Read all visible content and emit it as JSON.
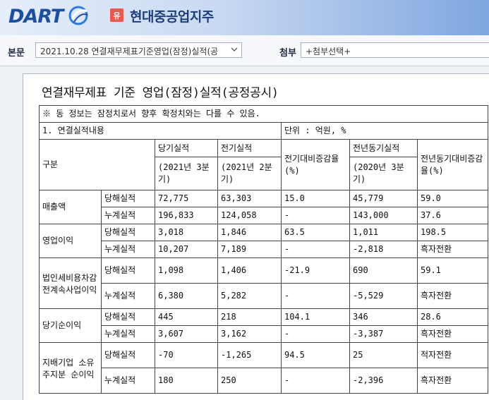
{
  "header": {
    "logo_text": "DART",
    "company_badge": "유",
    "company_name": "현대중공업지주"
  },
  "toolbar": {
    "doc_label": "본문",
    "doc_value": "2021.10.28  연결재무제표기준영업(잠정)실적(공",
    "attach_label": "첨부",
    "attach_value": "+첨부선택+"
  },
  "document": {
    "title": "연결재무제표 기준 영업(잠정)실적(공정공시)",
    "note": "※ 동 정보는 잠정치로서 향후 확정치와는 다를 수 있음.",
    "section": "1. 연결실적내용",
    "unit": "단위 : 억원, %",
    "headers": {
      "category": "구분",
      "current": "당기실적",
      "current_period": "(2021년 3분기)",
      "previous": "전기실적",
      "previous_period": "(2021년 2분기)",
      "qoq": "전기대비증감율(%)",
      "yoy_prev": "전년동기실적",
      "yoy_prev_period": "(2020년 3분기)",
      "yoy": "전년동기대비증감율(%)"
    },
    "rows": [
      {
        "name": "매출액",
        "sub": [
          {
            "type": "당해실적",
            "cur": "72,775",
            "prev": "63,303",
            "qoq": "15.0",
            "yoyp": "45,779",
            "yoy": "59.0"
          },
          {
            "type": "누계실적",
            "cur": "196,833",
            "prev": "124,058",
            "qoq": "-",
            "yoyp": "143,000",
            "yoy": "37.6"
          }
        ]
      },
      {
        "name": "영업이익",
        "sub": [
          {
            "type": "당해실적",
            "cur": "3,018",
            "prev": "1,846",
            "qoq": "63.5",
            "yoyp": "1,011",
            "yoy": "198.5"
          },
          {
            "type": "누계실적",
            "cur": "10,207",
            "prev": "7,189",
            "qoq": "-",
            "yoyp": "-2,818",
            "yoy": "흑자전환"
          }
        ]
      },
      {
        "name": "법인세비용차감전계속사업이익",
        "sub": [
          {
            "type": "당해실적",
            "cur": "1,098",
            "prev": "1,406",
            "qoq": "-21.9",
            "yoyp": "690",
            "yoy": "59.1"
          },
          {
            "type": "누계실적",
            "cur": "6,380",
            "prev": "5,282",
            "qoq": "-",
            "yoyp": "-5,529",
            "yoy": "흑자전환"
          }
        ]
      },
      {
        "name": "당기순이익",
        "sub": [
          {
            "type": "당해실적",
            "cur": "445",
            "prev": "218",
            "qoq": "104.1",
            "yoyp": "346",
            "yoy": "28.6"
          },
          {
            "type": "누계실적",
            "cur": "3,607",
            "prev": "3,162",
            "qoq": "-",
            "yoyp": "-3,387",
            "yoy": "흑자전환"
          }
        ]
      },
      {
        "name": "지배기업 소유주지분 순이익",
        "sub": [
          {
            "type": "당해실적",
            "cur": "-70",
            "prev": "-1,265",
            "qoq": "94.5",
            "yoyp": "25",
            "yoy": "적자전환"
          },
          {
            "type": "누계실적",
            "cur": "180",
            "prev": "250",
            "qoq": "-",
            "yoyp": "-2,396",
            "yoy": "흑자전환"
          }
        ]
      }
    ]
  },
  "colors": {
    "logo_blue": "#1c4fa3",
    "badge_red": "#e8594f",
    "company_navy": "#1f3f7a"
  }
}
